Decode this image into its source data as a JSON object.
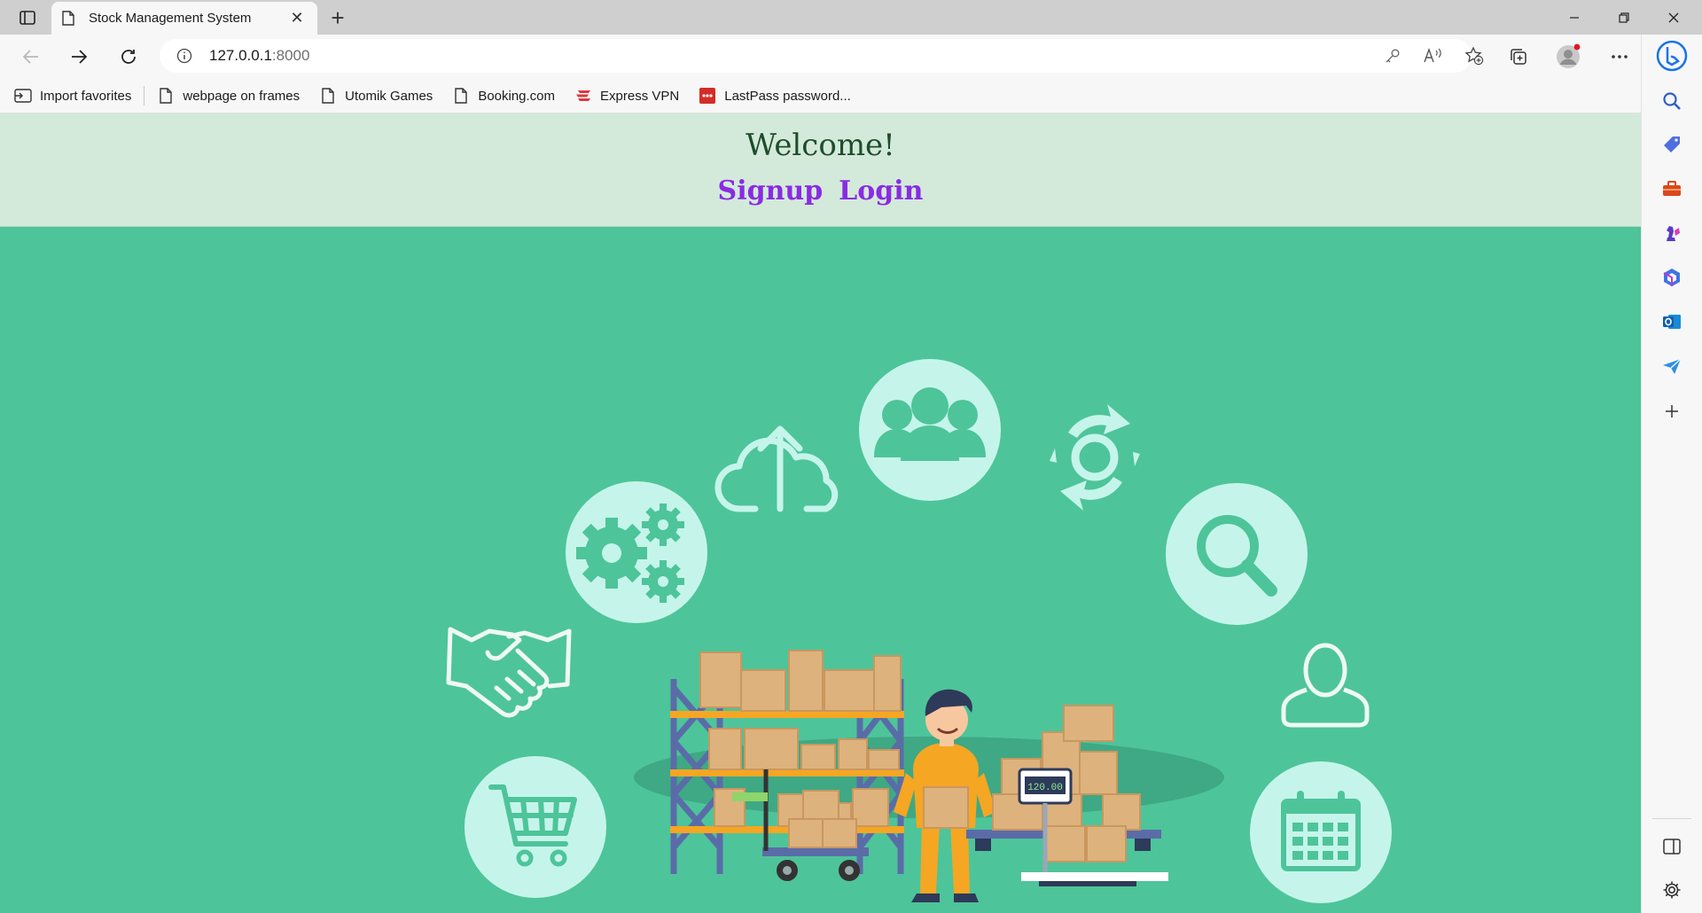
{
  "browser": {
    "tab": {
      "title": "Stock Management System",
      "close": "✕"
    },
    "new_tab": "+",
    "address": {
      "host": "127.0.0.1",
      "port": ":8000"
    },
    "favorites": [
      {
        "label": "Import favorites",
        "icon": "import-icon"
      },
      {
        "label": "webpage on frames",
        "icon": "page-icon"
      },
      {
        "label": "Utomik Games",
        "icon": "page-icon"
      },
      {
        "label": "Booking.com",
        "icon": "page-icon"
      },
      {
        "label": "Express VPN",
        "icon": "expressvpn-icon"
      },
      {
        "label": "LastPass password...",
        "icon": "lastpass-icon"
      }
    ]
  },
  "page": {
    "welcome": "Welcome!",
    "signup_label": "Signup",
    "login_label": "Login",
    "scale_display": "120.00"
  },
  "colors": {
    "page_background": "#4ec49a",
    "header_background": "#d3eadb",
    "link_color": "#8a2be2",
    "welcome_color": "#1f4d2b",
    "icon_circle": "#c5f5ea"
  }
}
